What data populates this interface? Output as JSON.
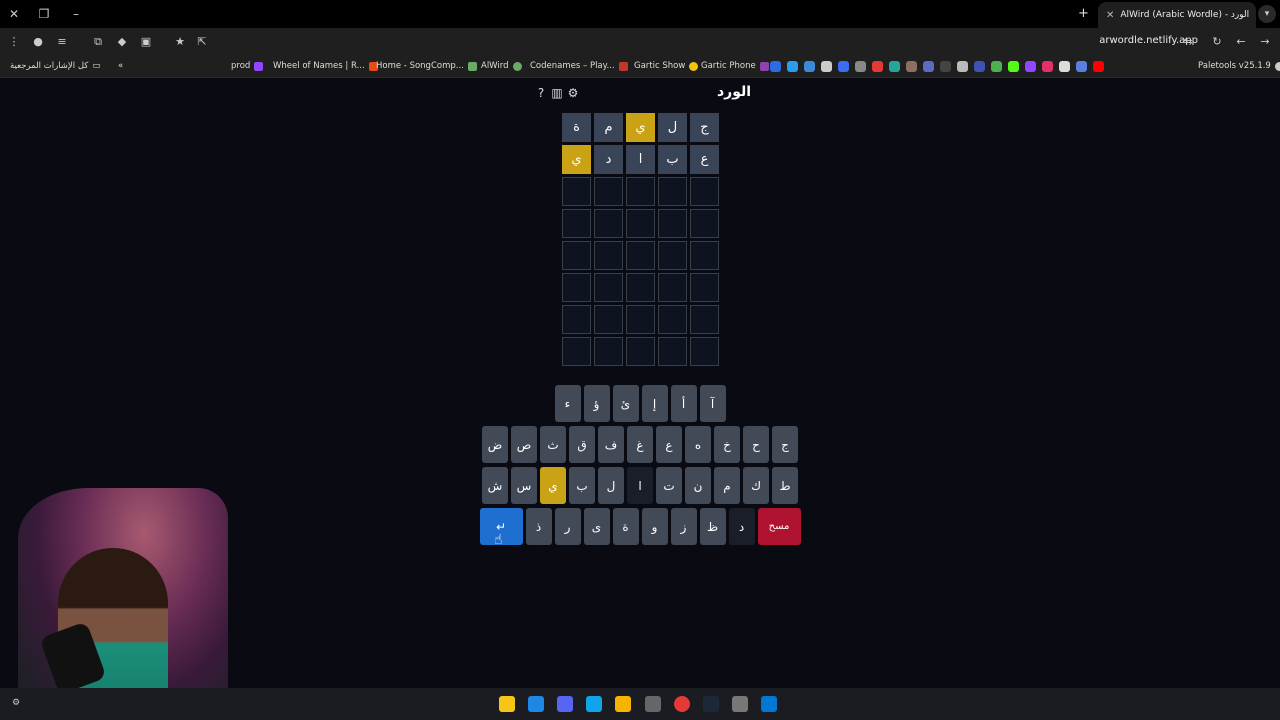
{
  "browser": {
    "tab_title": "AlWird (Arabic Wordle) - الورد",
    "url": "arwordle.netlify.app",
    "bookmarks": [
      {
        "label": "prod",
        "color": "#9146ff"
      },
      {
        "label": "Wheel of Names | R...",
        "color": "#e64a19"
      },
      {
        "label": "Home - SongComp...",
        "color": "#6aaa64"
      },
      {
        "label": "AlWird",
        "color": "#6aaa64"
      },
      {
        "label": "Codenames – Play...",
        "color": "#c0392b"
      },
      {
        "label": "Gartic Show",
        "color": "#f1c40f"
      },
      {
        "label": "Gartic Phone",
        "color": "#8e44ad"
      }
    ],
    "bookmarks_folder": "كل الإشارات المرجعية",
    "paletools": "Paletools v25.1.9"
  },
  "game": {
    "title": "الورد",
    "icons": [
      "help-icon",
      "stats-icon",
      "settings-icon"
    ],
    "board": [
      [
        {
          "l": "ج",
          "s": "absent"
        },
        {
          "l": "ل",
          "s": "absent"
        },
        {
          "l": "ي",
          "s": "present"
        },
        {
          "l": "م",
          "s": "absent"
        },
        {
          "l": "ة",
          "s": "absent"
        }
      ],
      [
        {
          "l": "ع",
          "s": "absent"
        },
        {
          "l": "ب",
          "s": "absent"
        },
        {
          "l": "ا",
          "s": "absent"
        },
        {
          "l": "د",
          "s": "absent"
        },
        {
          "l": "ي",
          "s": "present"
        }
      ],
      [
        {
          "l": "",
          "s": "empty"
        },
        {
          "l": "",
          "s": "empty"
        },
        {
          "l": "",
          "s": "empty"
        },
        {
          "l": "",
          "s": "empty"
        },
        {
          "l": "",
          "s": "empty"
        }
      ],
      [
        {
          "l": "",
          "s": "empty"
        },
        {
          "l": "",
          "s": "empty"
        },
        {
          "l": "",
          "s": "empty"
        },
        {
          "l": "",
          "s": "empty"
        },
        {
          "l": "",
          "s": "empty"
        }
      ],
      [
        {
          "l": "",
          "s": "empty"
        },
        {
          "l": "",
          "s": "empty"
        },
        {
          "l": "",
          "s": "empty"
        },
        {
          "l": "",
          "s": "empty"
        },
        {
          "l": "",
          "s": "empty"
        }
      ],
      [
        {
          "l": "",
          "s": "empty"
        },
        {
          "l": "",
          "s": "empty"
        },
        {
          "l": "",
          "s": "empty"
        },
        {
          "l": "",
          "s": "empty"
        },
        {
          "l": "",
          "s": "empty"
        }
      ],
      [
        {
          "l": "",
          "s": "empty"
        },
        {
          "l": "",
          "s": "empty"
        },
        {
          "l": "",
          "s": "empty"
        },
        {
          "l": "",
          "s": "empty"
        },
        {
          "l": "",
          "s": "empty"
        }
      ],
      [
        {
          "l": "",
          "s": "empty"
        },
        {
          "l": "",
          "s": "empty"
        },
        {
          "l": "",
          "s": "empty"
        },
        {
          "l": "",
          "s": "empty"
        },
        {
          "l": "",
          "s": "empty"
        }
      ]
    ],
    "keyboard": [
      [
        {
          "k": "آ"
        },
        {
          "k": "أ"
        },
        {
          "k": "إ"
        },
        {
          "k": "ئ"
        },
        {
          "k": "ؤ"
        },
        {
          "k": "ء"
        }
      ],
      [
        {
          "k": "ج"
        },
        {
          "k": "ح"
        },
        {
          "k": "خ"
        },
        {
          "k": "ه"
        },
        {
          "k": "ع"
        },
        {
          "k": "غ"
        },
        {
          "k": "ف"
        },
        {
          "k": "ق"
        },
        {
          "k": "ث"
        },
        {
          "k": "ص"
        },
        {
          "k": "ض"
        }
      ],
      [
        {
          "k": "ط"
        },
        {
          "k": "ك"
        },
        {
          "k": "م"
        },
        {
          "k": "ن"
        },
        {
          "k": "ت"
        },
        {
          "k": "ا",
          "s": "absent"
        },
        {
          "k": "ل"
        },
        {
          "k": "ب"
        },
        {
          "k": "ي",
          "s": "present"
        },
        {
          "k": "س"
        },
        {
          "k": "ش"
        }
      ],
      [
        {
          "k": "مسح",
          "s": "del"
        },
        {
          "k": "د",
          "s": "absent"
        },
        {
          "k": "ظ"
        },
        {
          "k": "ز"
        },
        {
          "k": "و"
        },
        {
          "k": "ة"
        },
        {
          "k": "ى"
        },
        {
          "k": "ر"
        },
        {
          "k": "ذ"
        },
        {
          "k": "↵",
          "s": "enter"
        }
      ]
    ]
  },
  "colors": {
    "present": "#c9a216",
    "absent": "#3a4457",
    "enter": "#1f6fd1",
    "delete": "#b0132f"
  }
}
